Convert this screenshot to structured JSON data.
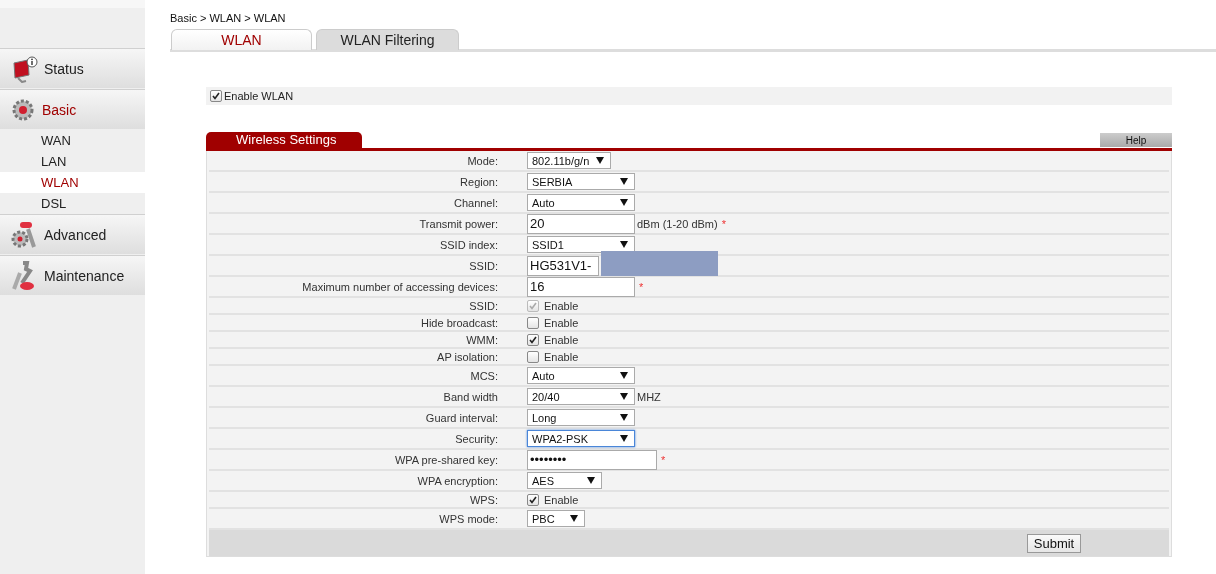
{
  "sidebar": {
    "items": [
      {
        "label": "Status",
        "selected": false
      },
      {
        "label": "Basic",
        "selected": true,
        "children": [
          {
            "label": "WAN",
            "selected": false
          },
          {
            "label": "LAN",
            "selected": false
          },
          {
            "label": "WLAN",
            "selected": true
          },
          {
            "label": "DSL",
            "selected": false
          }
        ]
      },
      {
        "label": "Advanced",
        "selected": false
      },
      {
        "label": "Maintenance",
        "selected": false
      }
    ]
  },
  "breadcrumb": "Basic > WLAN > WLAN",
  "tabs": [
    {
      "label": "WLAN",
      "selected": true
    },
    {
      "label": "WLAN Filtering",
      "selected": false
    }
  ],
  "enable_wlan": {
    "label": "Enable WLAN",
    "checked": true
  },
  "section": {
    "title": "Wireless Settings",
    "help": "Help"
  },
  "rows": [
    {
      "label": "Mode:",
      "kind": "select",
      "value": "802.11b/g/n",
      "focused": false
    },
    {
      "label": "Region:",
      "kind": "select",
      "value": "SERBIA",
      "focused": false
    },
    {
      "label": "Channel:",
      "kind": "select",
      "value": "Auto",
      "focused": false
    },
    {
      "label": "Transmit power:",
      "kind": "input",
      "value": "20",
      "suffix": "dBm (1-20 dBm)",
      "required_mark": "*"
    },
    {
      "label": "SSID index:",
      "kind": "select",
      "value": "SSID1",
      "focused": false
    },
    {
      "label": "SSID:",
      "kind": "input",
      "value": "HG531V1-",
      "redacted": true
    },
    {
      "label": "Maximum number of accessing devices:",
      "kind": "input",
      "value": "16",
      "required_mark": "*"
    },
    {
      "label": "SSID:",
      "kind": "checkbox",
      "value": "Enable",
      "checked": true,
      "disabled": true
    },
    {
      "label": "Hide broadcast:",
      "kind": "checkbox",
      "value": "Enable",
      "checked": false,
      "disabled": false
    },
    {
      "label": "WMM:",
      "kind": "checkbox",
      "value": "Enable",
      "checked": true,
      "disabled": false
    },
    {
      "label": "AP isolation:",
      "kind": "checkbox",
      "value": "Enable",
      "checked": false,
      "disabled": false
    },
    {
      "label": "MCS:",
      "kind": "select",
      "value": "Auto",
      "focused": false
    },
    {
      "label": "Band width",
      "kind": "select",
      "value": "20/40",
      "suffix": "MHZ",
      "focused": false
    },
    {
      "label": "Guard interval:",
      "kind": "select",
      "value": "Long",
      "focused": false
    },
    {
      "label": "Security:",
      "kind": "select",
      "value": "WPA2-PSK",
      "focused": true
    },
    {
      "label": "WPA pre-shared key:",
      "kind": "password",
      "value": "••••••••",
      "required_mark": "*"
    },
    {
      "label": "WPA encryption:",
      "kind": "select",
      "value": "AES",
      "focused": false
    },
    {
      "label": "WPS:",
      "kind": "checkbox",
      "value": "Enable",
      "checked": true,
      "disabled": false
    },
    {
      "label": "WPS mode:",
      "kind": "select",
      "value": "PBC",
      "focused": false
    }
  ],
  "submit": "Submit"
}
